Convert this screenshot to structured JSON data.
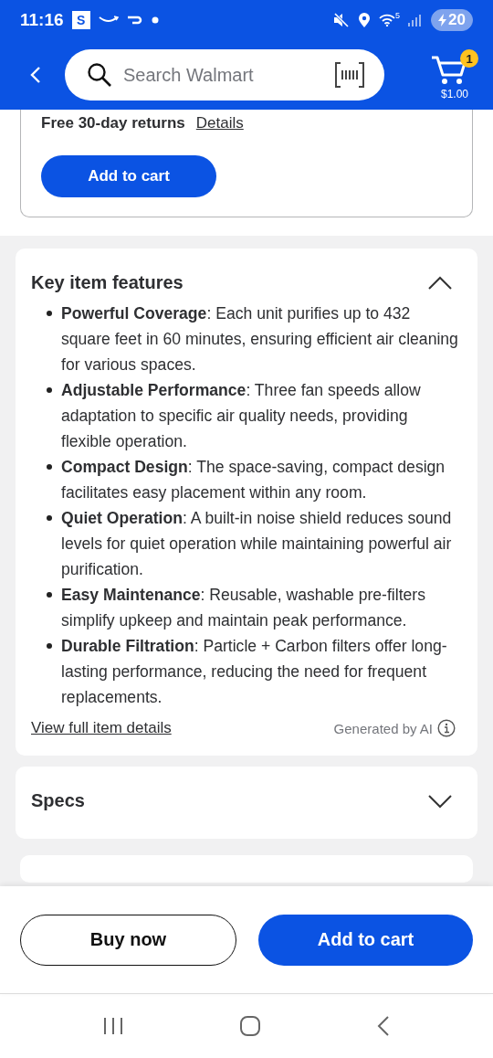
{
  "status_bar": {
    "time": "11:16",
    "app_badge": "S",
    "wifi_badge": "5",
    "battery": "20",
    "charging": true
  },
  "header": {
    "search": {
      "placeholder": "Search Walmart"
    },
    "cart": {
      "count": "1",
      "total": "$1.00"
    }
  },
  "buy_box": {
    "returns": "Free 30-day returns",
    "returns_link": "Details",
    "button": "Add to cart"
  },
  "sections": [
    {
      "title": "Key item features",
      "expanded": true,
      "features": [
        "**Powerful Coverage**: Each unit purifies up to 432 square feet in 60 minutes, ensuring efficient air cleaning for various spaces.",
        "**Adjustable Performance**: Three fan speeds allow adaptation to specific air quality needs, providing flexible operation.",
        "**Compact Design**: The space-saving, compact design facilitates easy placement within any room.",
        "**Quiet Operation**: A built-in noise shield reduces sound levels for quiet operation while maintaining powerful air purification.",
        "**Easy Maintenance**: Reusable, washable pre-filters simplify upkeep and maintain peak performance.",
        "**Durable Filtration**: Particle + Carbon filters offer long-lasting performance, reducing the need for frequent replacements."
      ],
      "link": "View full item details",
      "note": "Generated by AI"
    },
    {
      "title": "Specs",
      "expanded": false
    }
  ],
  "bottom_bar": {
    "buy_now": "Buy now",
    "add_to_cart": "Add to cart"
  }
}
